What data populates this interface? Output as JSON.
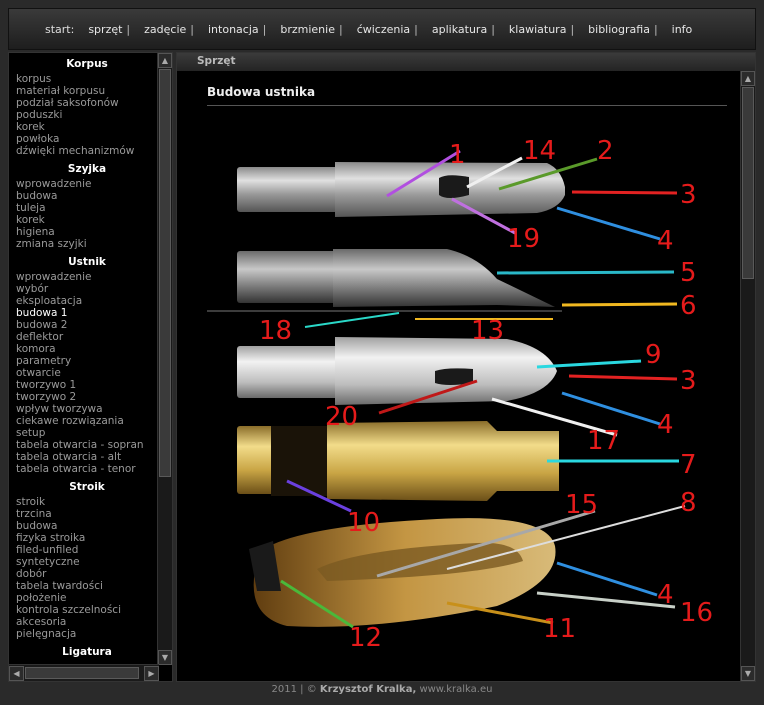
{
  "nav": {
    "start": "start:",
    "items": [
      "sprzęt",
      "zadęcie",
      "intonacja",
      "brzmienie",
      "ćwiczenia",
      "aplikatura",
      "klawiatura",
      "bibliografia",
      "info"
    ],
    "separator": "|"
  },
  "sidebar": {
    "sections": [
      {
        "title": "Korpus",
        "items": [
          "korpus",
          "materiał korpusu",
          "podział saksofonów",
          "poduszki",
          "korek",
          "powłoka",
          "dźwięki mechanizmów"
        ]
      },
      {
        "title": "Szyjka",
        "items": [
          "wprowadzenie",
          "budowa",
          "tuleja",
          "korek",
          "higiena",
          "zmiana szyjki"
        ]
      },
      {
        "title": "Ustnik",
        "items": [
          "wprowadzenie",
          "wybór",
          "eksploatacja",
          "budowa 1",
          "budowa 2",
          "deflektor",
          "komora",
          "parametry",
          "otwarcie",
          "tworzywo 1",
          "tworzywo 2",
          "wpływ tworzywa",
          "ciekawe rozwiązania",
          "setup",
          "tabela otwarcia - sopran",
          "tabela otwarcia - alt",
          "tabela otwarcia - tenor"
        ]
      },
      {
        "title": "Stroik",
        "items": [
          "stroik",
          "trzcina",
          "budowa",
          "fizyka stroika",
          "filed-unfiled",
          "syntetyczne",
          "dobór",
          "tabela twardości",
          "położenie",
          "kontrola szczelności",
          "akcesoria",
          "pielęgnacja"
        ]
      },
      {
        "title": "Ligatura",
        "items": []
      }
    ],
    "active_item": "budowa 1"
  },
  "main": {
    "header": "Sprzęt",
    "title": "Budowa ustnika",
    "labels": [
      "1",
      "14",
      "2",
      "3",
      "19",
      "4",
      "5",
      "6",
      "18",
      "13",
      "9",
      "3",
      "20",
      "4",
      "17",
      "7",
      "10",
      "15",
      "8",
      "4",
      "16",
      "11",
      "12"
    ]
  },
  "footer": {
    "year": "2011",
    "sep": "|",
    "copyright": "©",
    "author": "Krzysztof Kralka,",
    "site": "www.kralka.eu"
  }
}
